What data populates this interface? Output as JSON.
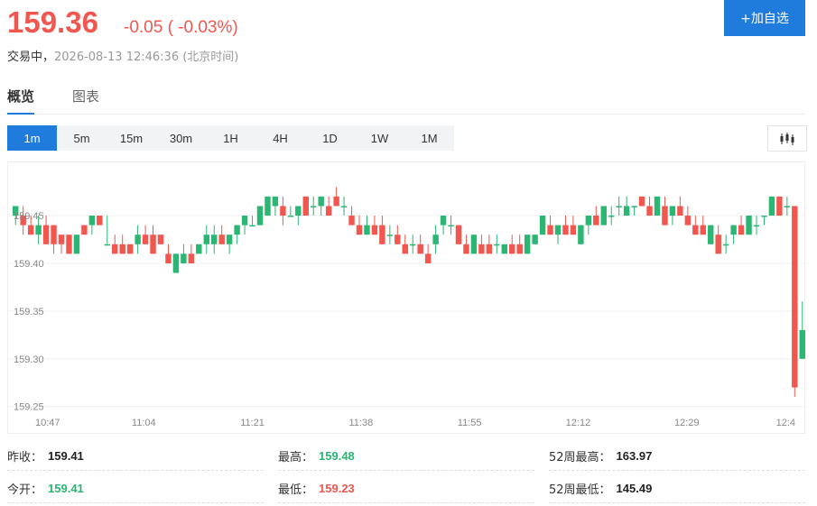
{
  "quote": {
    "price": "159.36",
    "change": "-0.05 ( -0.03%)",
    "status_label": "交易中，",
    "timestamp": "2026-08-13 12:46:36 (北京时间)"
  },
  "actions": {
    "add_watchlist_label": "+加自选"
  },
  "tabs": [
    {
      "label": "概览",
      "active": true
    },
    {
      "label": "图表",
      "active": false
    }
  ],
  "intervals": [
    {
      "label": "1m",
      "active": true
    },
    {
      "label": "5m",
      "active": false
    },
    {
      "label": "15m",
      "active": false
    },
    {
      "label": "30m",
      "active": false
    },
    {
      "label": "1H",
      "active": false
    },
    {
      "label": "4H",
      "active": false
    },
    {
      "label": "1D",
      "active": false
    },
    {
      "label": "1W",
      "active": false
    },
    {
      "label": "1M",
      "active": false
    }
  ],
  "icons": {
    "chart_type": "candlestick-icon"
  },
  "colors": {
    "up": "#2bb673",
    "down": "#f1564f",
    "accent": "#1f7bdc"
  },
  "chart_data": {
    "type": "candlestick",
    "ylim": [
      159.245,
      159.485
    ],
    "yticks": [
      "159.45",
      "159.40",
      "159.35",
      "159.30",
      "159.25"
    ],
    "xticks": [
      "10:47",
      "11:04",
      "11:21",
      "11:38",
      "11:55",
      "12:12",
      "12:29",
      "12:4"
    ],
    "grid": true,
    "candles_ohlc": [
      [
        159.45,
        159.46,
        159.44,
        159.46
      ],
      [
        159.45,
        159.46,
        159.43,
        159.44
      ],
      [
        159.44,
        159.45,
        159.43,
        159.43
      ],
      [
        159.43,
        159.45,
        159.42,
        159.44
      ],
      [
        159.44,
        159.45,
        159.42,
        159.42
      ],
      [
        159.44,
        159.44,
        159.41,
        159.42
      ],
      [
        159.43,
        159.43,
        159.41,
        159.42
      ],
      [
        159.43,
        159.43,
        159.41,
        159.41
      ],
      [
        159.41,
        159.43,
        159.41,
        159.43
      ],
      [
        159.44,
        159.44,
        159.43,
        159.43
      ],
      [
        159.44,
        159.45,
        159.43,
        159.45
      ],
      [
        159.45,
        159.45,
        159.44,
        159.44
      ],
      [
        159.42,
        159.45,
        159.42,
        159.42
      ],
      [
        159.42,
        159.43,
        159.41,
        159.41
      ],
      [
        159.42,
        159.43,
        159.41,
        159.41
      ],
      [
        159.42,
        159.42,
        159.41,
        159.41
      ],
      [
        159.42,
        159.44,
        159.41,
        159.43
      ],
      [
        159.43,
        159.44,
        159.42,
        159.42
      ],
      [
        159.43,
        159.44,
        159.41,
        159.41
      ],
      [
        159.43,
        159.43,
        159.42,
        159.42
      ],
      [
        159.41,
        159.42,
        159.4,
        159.4
      ],
      [
        159.39,
        159.41,
        159.39,
        159.41
      ],
      [
        159.4,
        159.42,
        159.4,
        159.41
      ],
      [
        159.41,
        159.42,
        159.4,
        159.4
      ],
      [
        159.41,
        159.42,
        159.41,
        159.42
      ],
      [
        159.42,
        159.44,
        159.41,
        159.43
      ],
      [
        159.42,
        159.44,
        159.41,
        159.43
      ],
      [
        159.43,
        159.44,
        159.42,
        159.42
      ],
      [
        159.42,
        159.43,
        159.41,
        159.43
      ],
      [
        159.43,
        159.44,
        159.42,
        159.44
      ],
      [
        159.44,
        159.45,
        159.43,
        159.45
      ],
      [
        159.44,
        159.45,
        159.44,
        159.44
      ],
      [
        159.44,
        159.46,
        159.44,
        159.46
      ],
      [
        159.45,
        159.47,
        159.45,
        159.47
      ],
      [
        159.46,
        159.47,
        159.45,
        159.47
      ],
      [
        159.46,
        159.47,
        159.44,
        159.45
      ],
      [
        159.45,
        159.46,
        159.45,
        159.45
      ],
      [
        159.45,
        159.46,
        159.44,
        159.46
      ],
      [
        159.47,
        159.47,
        159.45,
        159.45
      ],
      [
        159.46,
        159.47,
        159.45,
        159.46
      ],
      [
        159.46,
        159.47,
        159.45,
        159.47
      ],
      [
        159.46,
        159.47,
        159.45,
        159.45
      ],
      [
        159.47,
        159.48,
        159.46,
        159.46
      ],
      [
        159.46,
        159.47,
        159.45,
        159.46
      ],
      [
        159.45,
        159.46,
        159.44,
        159.44
      ],
      [
        159.44,
        159.45,
        159.43,
        159.43
      ],
      [
        159.43,
        159.45,
        159.43,
        159.44
      ],
      [
        159.44,
        159.45,
        159.43,
        159.43
      ],
      [
        159.44,
        159.45,
        159.42,
        159.42
      ],
      [
        159.43,
        159.44,
        159.42,
        159.43
      ],
      [
        159.43,
        159.44,
        159.42,
        159.42
      ],
      [
        159.42,
        159.43,
        159.41,
        159.41
      ],
      [
        159.42,
        159.43,
        159.41,
        159.42
      ],
      [
        159.42,
        159.43,
        159.41,
        159.41
      ],
      [
        159.41,
        159.42,
        159.4,
        159.4
      ],
      [
        159.42,
        159.44,
        159.41,
        159.43
      ],
      [
        159.44,
        159.45,
        159.43,
        159.45
      ],
      [
        159.44,
        159.45,
        159.43,
        159.44
      ],
      [
        159.44,
        159.44,
        159.42,
        159.42
      ],
      [
        159.42,
        159.43,
        159.41,
        159.41
      ],
      [
        159.41,
        159.43,
        159.41,
        159.43
      ],
      [
        159.42,
        159.43,
        159.41,
        159.41
      ],
      [
        159.42,
        159.43,
        159.41,
        159.41
      ],
      [
        159.42,
        159.43,
        159.41,
        159.42
      ],
      [
        159.41,
        159.42,
        159.41,
        159.42
      ],
      [
        159.42,
        159.43,
        159.41,
        159.41
      ],
      [
        159.42,
        159.43,
        159.41,
        159.41
      ],
      [
        159.41,
        159.43,
        159.41,
        159.43
      ],
      [
        159.42,
        159.43,
        159.42,
        159.43
      ],
      [
        159.43,
        159.45,
        159.43,
        159.45
      ],
      [
        159.44,
        159.45,
        159.43,
        159.43
      ],
      [
        159.43,
        159.44,
        159.42,
        159.44
      ],
      [
        159.44,
        159.45,
        159.43,
        159.43
      ],
      [
        159.44,
        159.45,
        159.43,
        159.43
      ],
      [
        159.42,
        159.44,
        159.42,
        159.44
      ],
      [
        159.44,
        159.45,
        159.43,
        159.45
      ],
      [
        159.45,
        159.46,
        159.44,
        159.44
      ],
      [
        159.44,
        159.46,
        159.44,
        159.46
      ],
      [
        159.45,
        159.46,
        159.44,
        159.45
      ],
      [
        159.46,
        159.47,
        159.45,
        159.46
      ],
      [
        159.45,
        159.47,
        159.45,
        159.46
      ],
      [
        159.46,
        159.46,
        159.45,
        159.46
      ],
      [
        159.47,
        159.47,
        159.46,
        159.46
      ],
      [
        159.46,
        159.47,
        159.45,
        159.45
      ],
      [
        159.45,
        159.47,
        159.45,
        159.47
      ],
      [
        159.46,
        159.47,
        159.44,
        159.44
      ],
      [
        159.45,
        159.46,
        159.44,
        159.46
      ],
      [
        159.46,
        159.47,
        159.45,
        159.45
      ],
      [
        159.45,
        159.46,
        159.44,
        159.44
      ],
      [
        159.44,
        159.45,
        159.43,
        159.43
      ],
      [
        159.44,
        159.45,
        159.43,
        159.43
      ],
      [
        159.42,
        159.44,
        159.42,
        159.44
      ],
      [
        159.43,
        159.44,
        159.41,
        159.41
      ],
      [
        159.42,
        159.43,
        159.41,
        159.42
      ],
      [
        159.43,
        159.44,
        159.42,
        159.44
      ],
      [
        159.44,
        159.45,
        159.43,
        159.43
      ],
      [
        159.43,
        159.45,
        159.43,
        159.45
      ],
      [
        159.44,
        159.45,
        159.43,
        159.44
      ],
      [
        159.45,
        159.45,
        159.44,
        159.45
      ],
      [
        159.45,
        159.47,
        159.45,
        159.47
      ],
      [
        159.47,
        159.47,
        159.45,
        159.45
      ],
      [
        159.46,
        159.47,
        159.45,
        159.46
      ],
      [
        159.46,
        159.46,
        159.26,
        159.27
      ],
      [
        159.3,
        159.36,
        159.3,
        159.33
      ]
    ]
  },
  "stats": {
    "prev_close": {
      "label": "昨收：",
      "value": "159.41"
    },
    "open": {
      "label": "今开：",
      "value": "159.41"
    },
    "high": {
      "label": "最高：",
      "value": "159.48"
    },
    "low": {
      "label": "最低：",
      "value": "159.23"
    },
    "high_52w": {
      "label": "52周最高：",
      "value": "163.97"
    },
    "low_52w": {
      "label": "52周最低：",
      "value": "145.49"
    }
  }
}
